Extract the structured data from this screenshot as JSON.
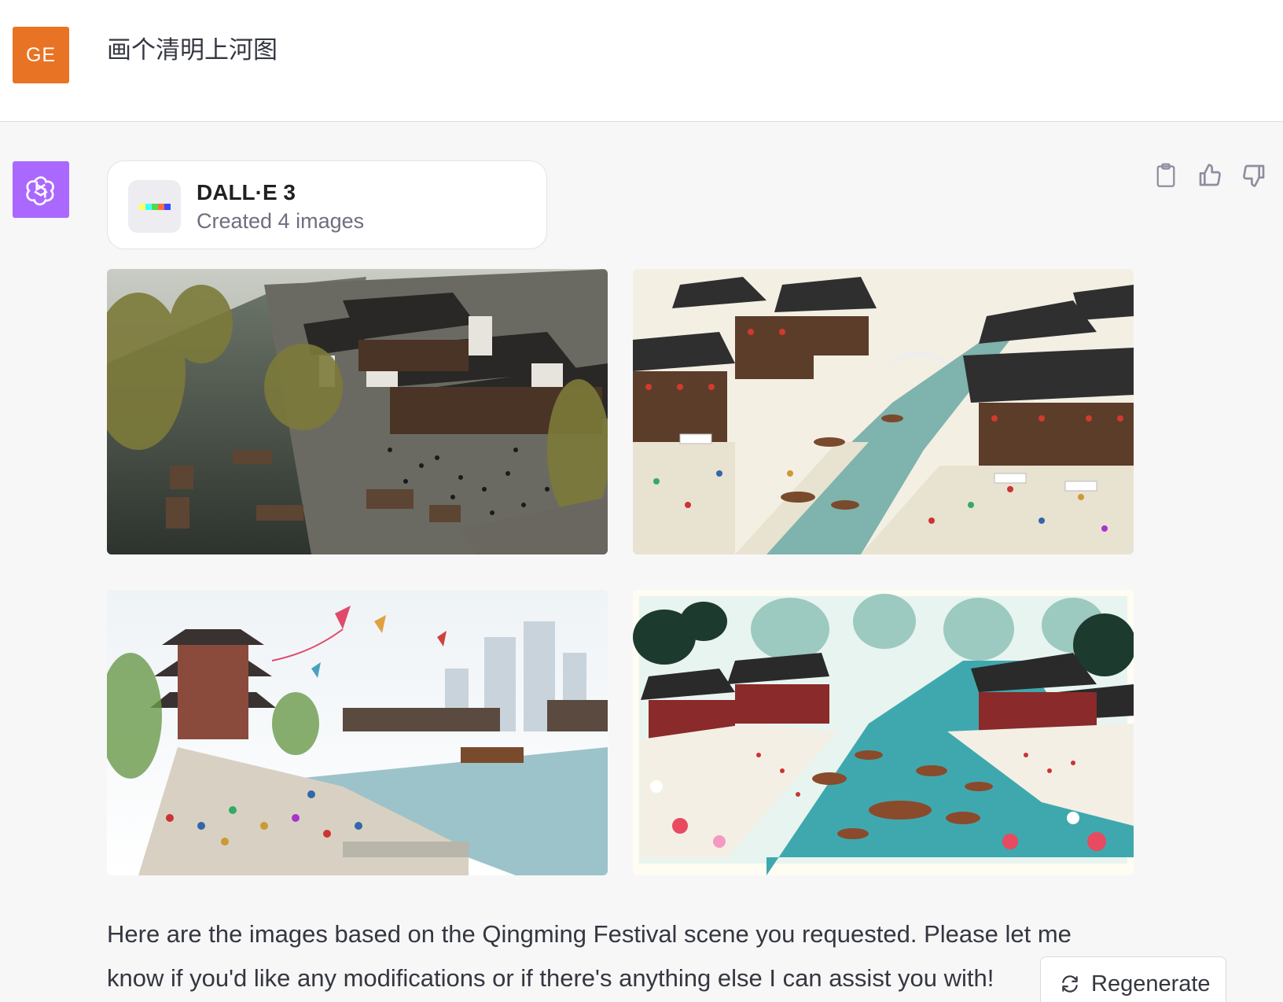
{
  "user": {
    "avatar_initials": "GE",
    "avatar_color": "#e97325",
    "message": "画个清明上河图"
  },
  "assistant": {
    "avatar_icon": "openai-logo-icon",
    "avatar_color": "#ab68ff",
    "tool": {
      "name": "DALL·E 3",
      "status": "Created 4 images",
      "icon": "dalle-palette-icon"
    },
    "actions": [
      {
        "name": "copy-button",
        "icon": "clipboard-icon"
      },
      {
        "name": "thumbs-up-button",
        "icon": "thumbs-up-icon"
      },
      {
        "name": "thumbs-down-button",
        "icon": "thumbs-down-icon"
      }
    ],
    "images": [
      {
        "style": "photorealistic canal town"
      },
      {
        "style": "illustrated canal market"
      },
      {
        "style": "watercolor riverside with kites"
      },
      {
        "style": "papercut-style canal scene"
      }
    ],
    "reply": "Here are the images based on the Qingming Festival scene you requested. Please let me know if you'd like any modifications or if there's anything else I can assist you with!",
    "regenerate_label": "Regenerate"
  }
}
